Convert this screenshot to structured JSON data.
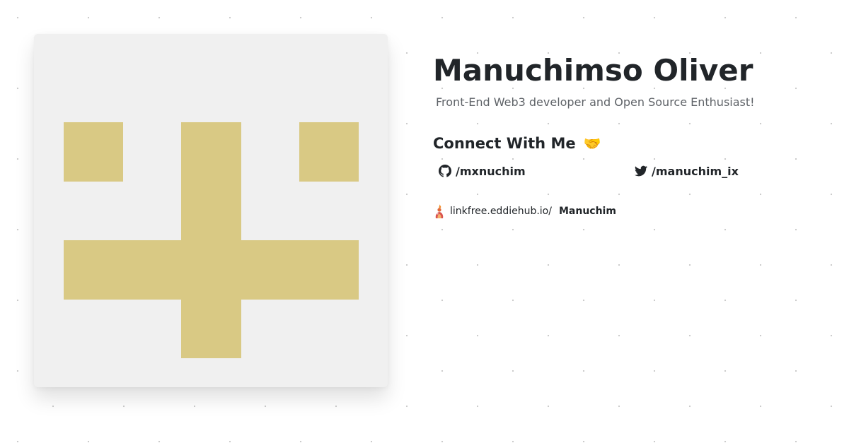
{
  "profile": {
    "name": "Manuchimso Oliver",
    "tagline": "Front-End Web3 developer and Open Source Enthusiast!"
  },
  "avatar": {
    "icon": "identicon-avatar",
    "background_color": "#f0f0f0",
    "pattern_color": "#d9c984"
  },
  "connect": {
    "heading": "Connect With Me",
    "emoji": "🤝",
    "github": {
      "icon": "github-icon",
      "label": "/mxnuchim"
    },
    "twitter": {
      "icon": "twitter-icon",
      "label": "/manuchim_ix"
    }
  },
  "linkfree": {
    "icon": "linkfree-logo-icon",
    "domain": "linkfree.eddiehub.io/",
    "username": "Manuchim"
  },
  "colors": {
    "text_primary": "#212529",
    "text_secondary": "#5f6368"
  }
}
